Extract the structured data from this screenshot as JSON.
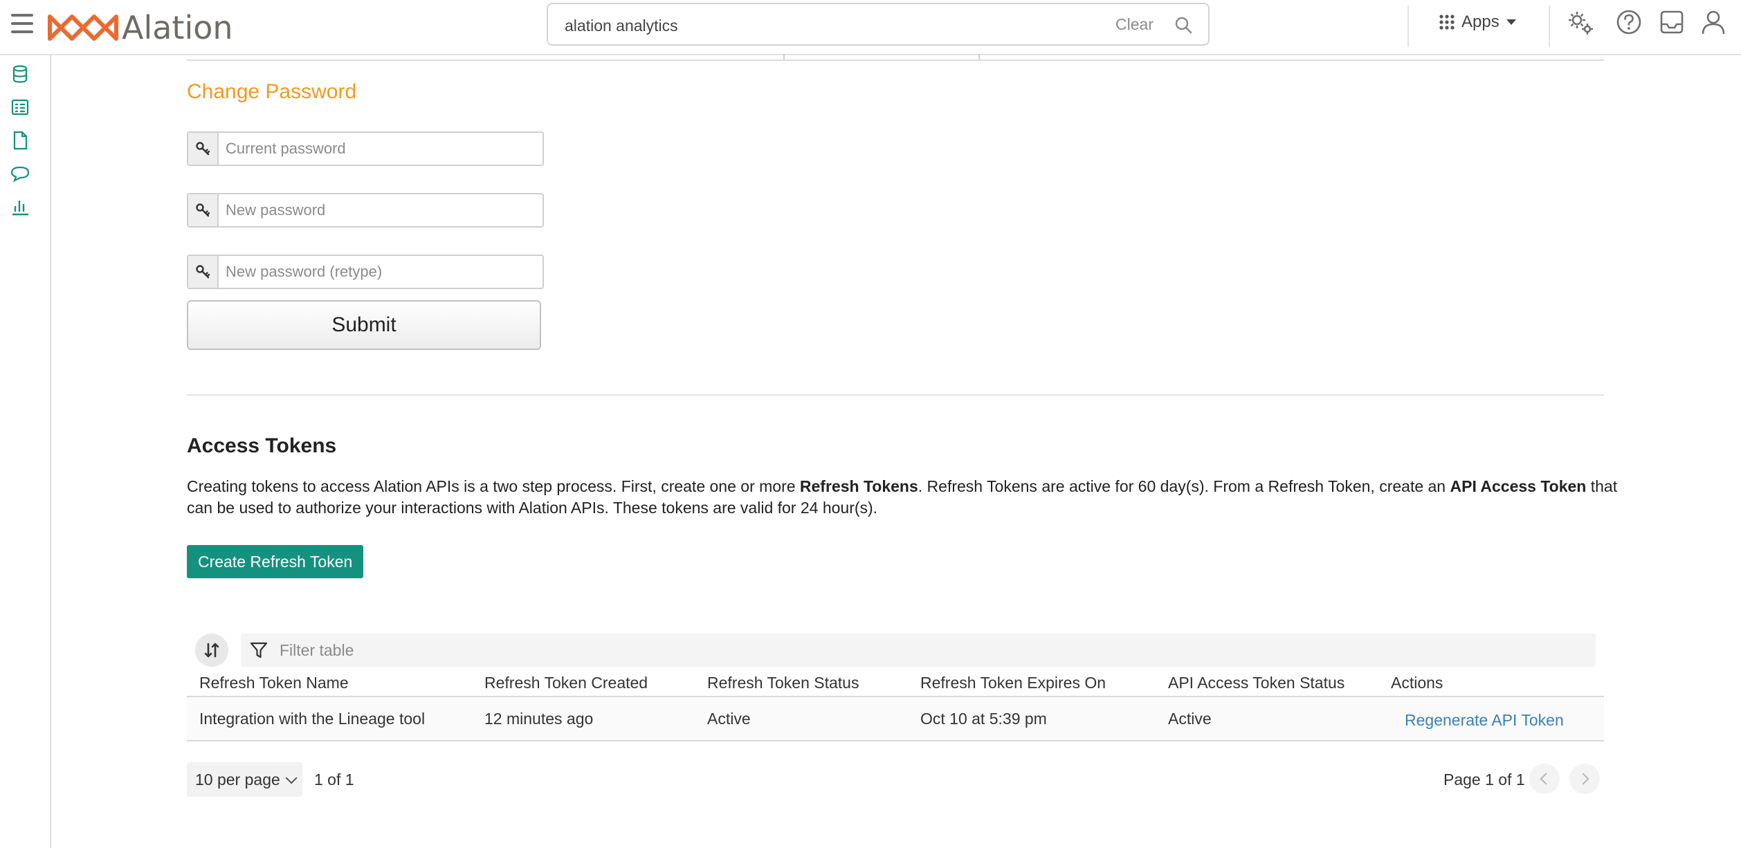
{
  "header": {
    "logo_text": "Alation",
    "search": {
      "value": "alation analytics",
      "clear_label": "Clear"
    },
    "apps_label": "Apps"
  },
  "colors": {
    "accent_teal": "#14917f",
    "accent_orange": "#f29a1c",
    "logo_orange": "#ea6a30",
    "link_blue": "#3b7fb8"
  },
  "icons": {
    "topbar": [
      "menu-icon",
      "search-icon",
      "apps-grid-icon",
      "settings-gears-icon",
      "help-icon",
      "inbox-icon",
      "user-icon"
    ],
    "left_rail": [
      "database-icon",
      "catalog-icon",
      "document-icon",
      "conversation-icon",
      "analytics-icon"
    ]
  },
  "change_password": {
    "title": "Change Password",
    "current_placeholder": "Current password",
    "new_placeholder": "New password",
    "retype_placeholder": "New password (retype)",
    "submit_label": "Submit"
  },
  "access_tokens": {
    "title": "Access Tokens",
    "desc": {
      "p1": "Creating tokens to access Alation APIs is a two step process. First, create one or more ",
      "b1": "Refresh Tokens",
      "p2": ". Refresh Tokens are active for 60 day(s). From a Refresh Token, create an ",
      "b2": "API Access Token",
      "p3": " that can be used to authorize your interactions with Alation APIs. These tokens are valid for 24 hour(s)."
    },
    "create_label": "Create Refresh Token",
    "filter_placeholder": "Filter table",
    "columns": [
      "Refresh Token Name",
      "Refresh Token Created",
      "Refresh Token Status",
      "Refresh Token Expires On",
      "API Access Token Status",
      "Actions"
    ],
    "rows": [
      {
        "name": "Integration with the Lineage tool",
        "created": "12 minutes ago",
        "status": "Active",
        "expires": "Oct 10 at 5:39 pm",
        "api_status": "Active",
        "action": "Regenerate API Token"
      }
    ],
    "pagination": {
      "per_page": "10 per page",
      "count": "1 of 1",
      "page": "Page 1 of 1"
    }
  }
}
